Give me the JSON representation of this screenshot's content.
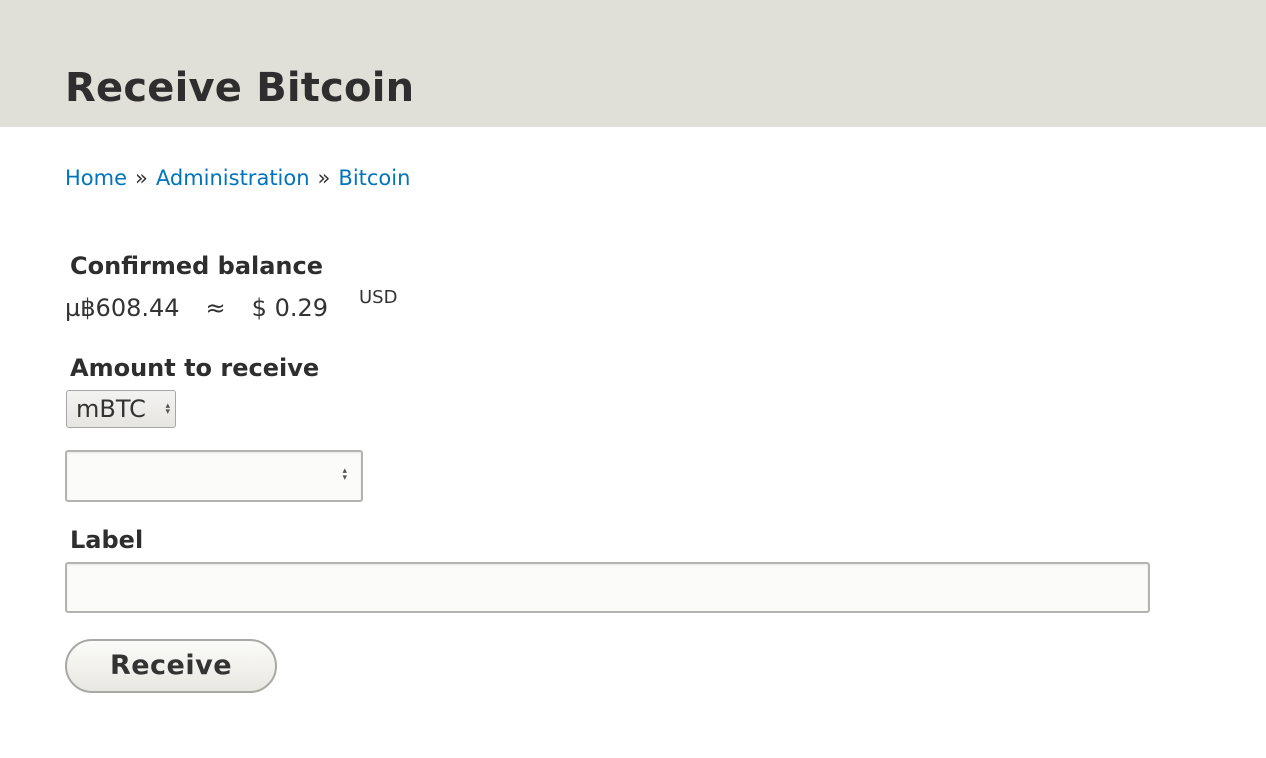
{
  "page": {
    "title": "Receive Bitcoin"
  },
  "breadcrumb": {
    "items": [
      "Home",
      "Administration",
      "Bitcoin"
    ],
    "separator": "»"
  },
  "balance": {
    "label": "Confirmed balance",
    "btc_symbol": "µ฿",
    "btc_amount": "608.44",
    "approx": "≈",
    "fiat_symbol": "$",
    "fiat_amount": "0.29",
    "fiat_code": "USD"
  },
  "amount": {
    "label": "Amount to receive",
    "unit_selected": "mBTC",
    "value": ""
  },
  "label_field": {
    "label": "Label",
    "value": ""
  },
  "actions": {
    "receive_label": "Receive"
  },
  "colors": {
    "header_bg": "#e0dfd8",
    "link": "#0074bd",
    "text": "#333333"
  }
}
